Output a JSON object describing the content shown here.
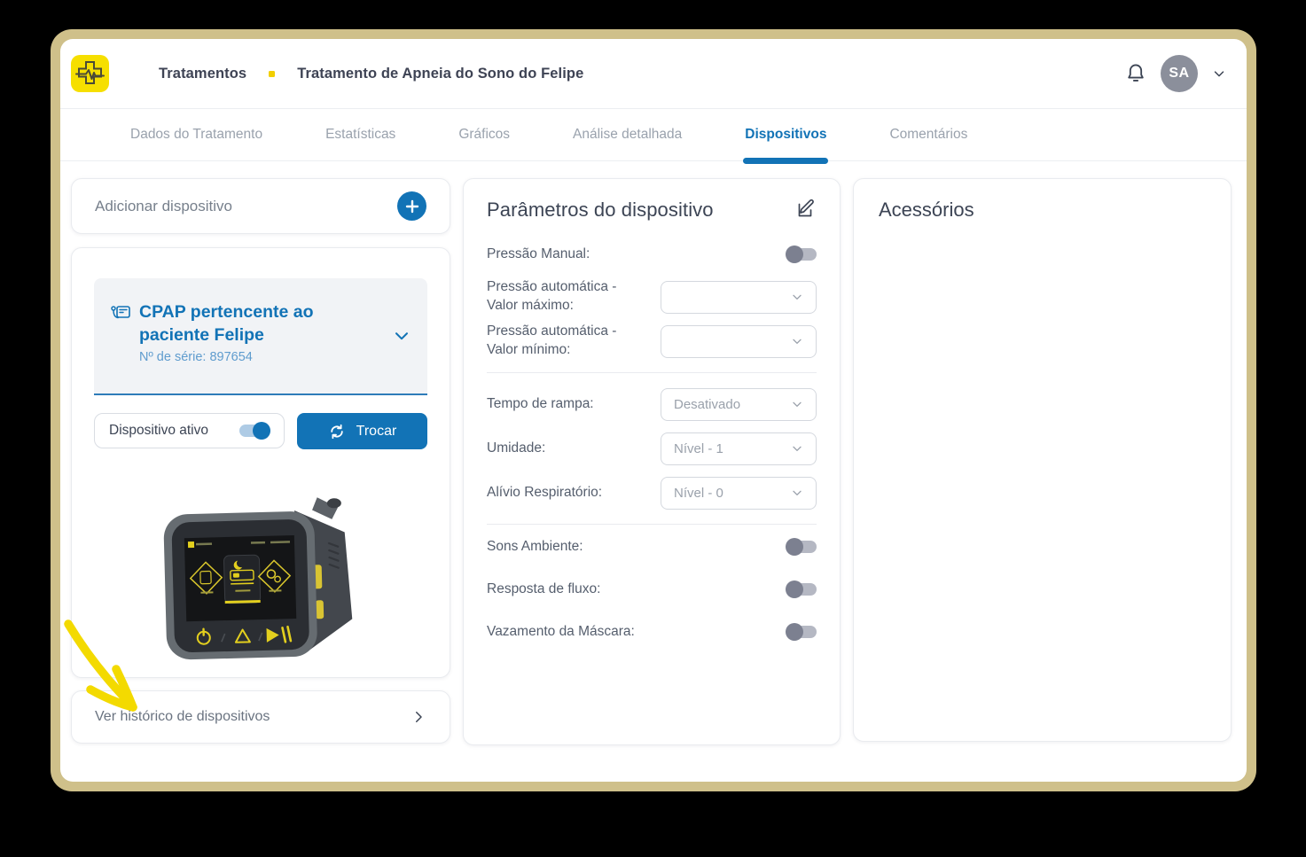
{
  "header": {
    "brand_icon": "medical-cross-heartbeat",
    "breadcrumb": {
      "root": "Tratamentos",
      "current": "Tratamento de Apneia do Sono do Felipe"
    },
    "notifications_icon": "bell",
    "avatar_initials": "SA"
  },
  "tabs": [
    {
      "label": "Dados do Tratamento",
      "active": false
    },
    {
      "label": "Estatísticas",
      "active": false
    },
    {
      "label": "Gráficos",
      "active": false
    },
    {
      "label": "Análise detalhada",
      "active": false
    },
    {
      "label": "Dispositivos",
      "active": true
    },
    {
      "label": "Comentários",
      "active": false
    }
  ],
  "left_column": {
    "add_device": {
      "label": "Adicionar dispositivo"
    },
    "device_card": {
      "title": "CPAP pertencente ao paciente Felipe",
      "serial": "Nº de série: 897654",
      "active_toggle_label": "Dispositivo ativo",
      "active": true,
      "swap_button_label": "Trocar"
    },
    "history_link": {
      "label": "Ver histórico de dispositivos"
    }
  },
  "parameters": {
    "title": "Parâmetros do dispositivo",
    "rows": [
      {
        "type": "toggle",
        "label": "Pressão Manual:",
        "on": false
      },
      {
        "type": "select",
        "label": "Pressão automática - Valor máximo:",
        "value": ""
      },
      {
        "type": "select",
        "label": "Pressão automática - Valor mínimo:",
        "value": ""
      },
      {
        "type": "select",
        "label": "Tempo de rampa:",
        "value": "Desativado"
      },
      {
        "type": "select",
        "label": "Umidade:",
        "value": "Nível - 1"
      },
      {
        "type": "select",
        "label": "Alívio Respiratório:",
        "value": "Nível - 0"
      },
      {
        "type": "toggle",
        "label": "Sons Ambiente:",
        "on": false
      },
      {
        "type": "toggle",
        "label": "Resposta de fluxo:",
        "on": false
      },
      {
        "type": "toggle",
        "label": "Vazamento da Máscara:",
        "on": false
      }
    ]
  },
  "accessories": {
    "title": "Acessórios"
  },
  "colors": {
    "accent_blue": "#1273b6",
    "brand_yellow": "#f6df00",
    "annotation_yellow": "#f3da00",
    "frame_tan": "#cfc08a",
    "toggle_on_knob": "#1273b6",
    "toggle_off_knob": "#7c8090",
    "device_screen_yellow": "#e3cf1e"
  }
}
